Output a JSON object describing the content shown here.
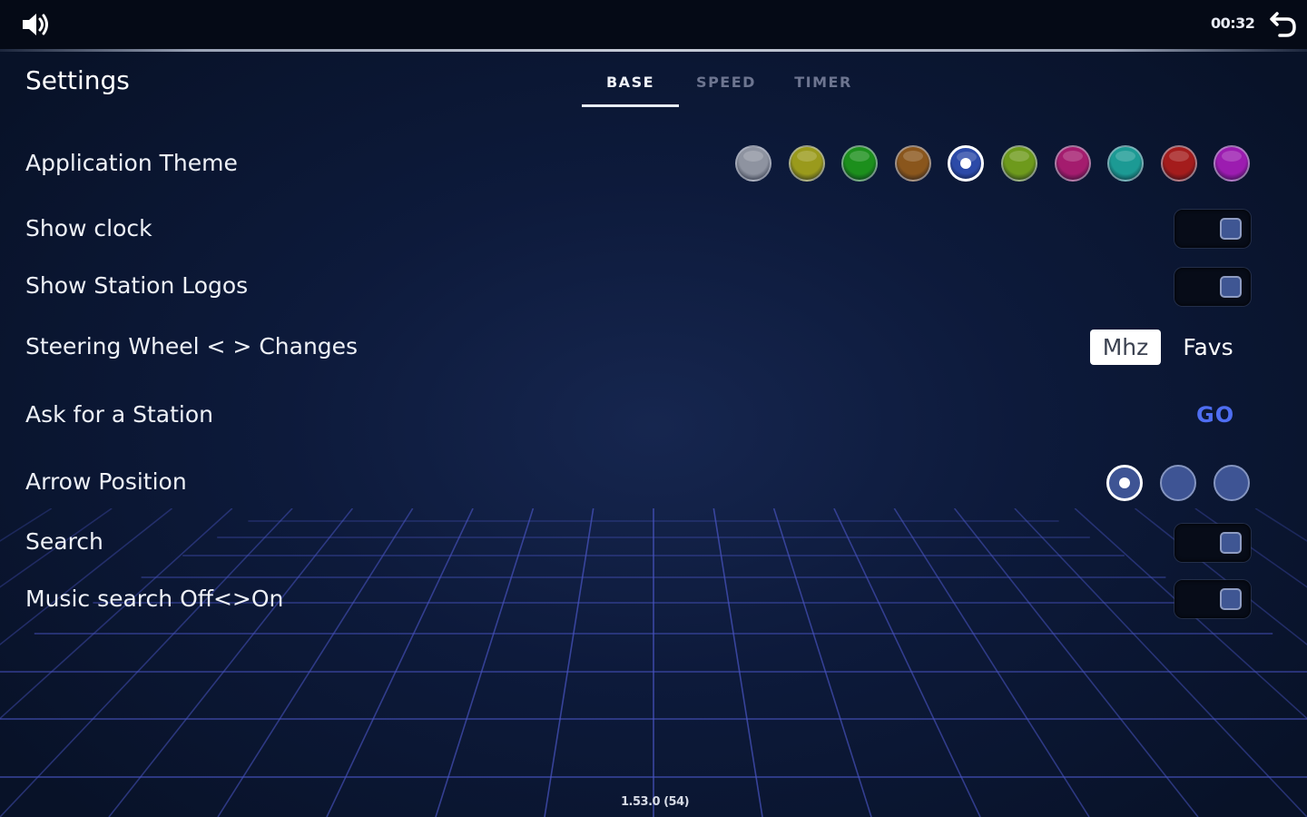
{
  "status_bar": {
    "time": "00:32",
    "volume_icon": "speaker-icon",
    "back_icon": "back-arrow-icon"
  },
  "header": {
    "title": "Settings",
    "tabs": [
      {
        "label": "BASE",
        "active": true
      },
      {
        "label": "SPEED",
        "active": false
      },
      {
        "label": "TIMER",
        "active": false
      }
    ]
  },
  "settings": {
    "theme": {
      "label": "Application Theme",
      "colors": [
        "#8e93a0",
        "#9a9a1c",
        "#1c8f1c",
        "#8a561c",
        "#2c4aa8",
        "#6e9a1c",
        "#a41c6e",
        "#1c9a94",
        "#a41c1c",
        "#9c1cb0"
      ],
      "selected_index": 4
    },
    "show_clock": {
      "label": "Show clock",
      "state": "on"
    },
    "show_logos": {
      "label": "Show Station Logos",
      "state": "on"
    },
    "steering": {
      "label": "Steering Wheel < > Changes",
      "options": [
        "Mhz",
        "Favs"
      ],
      "selected": "Mhz"
    },
    "ask_station": {
      "label": "Ask for a Station",
      "action": "GO"
    },
    "arrow_position": {
      "label": "Arrow Position",
      "options_count": 3,
      "selected_index": 0
    },
    "search": {
      "label": "Search",
      "state": "on"
    },
    "music_search": {
      "label": "Music search Off<>On",
      "state": "on"
    }
  },
  "footer": {
    "version": "1.53.0 (54)"
  },
  "colors": {
    "accent": "#4f6ef2",
    "background": "#0d1a3b",
    "grid": "#4a55c4"
  }
}
